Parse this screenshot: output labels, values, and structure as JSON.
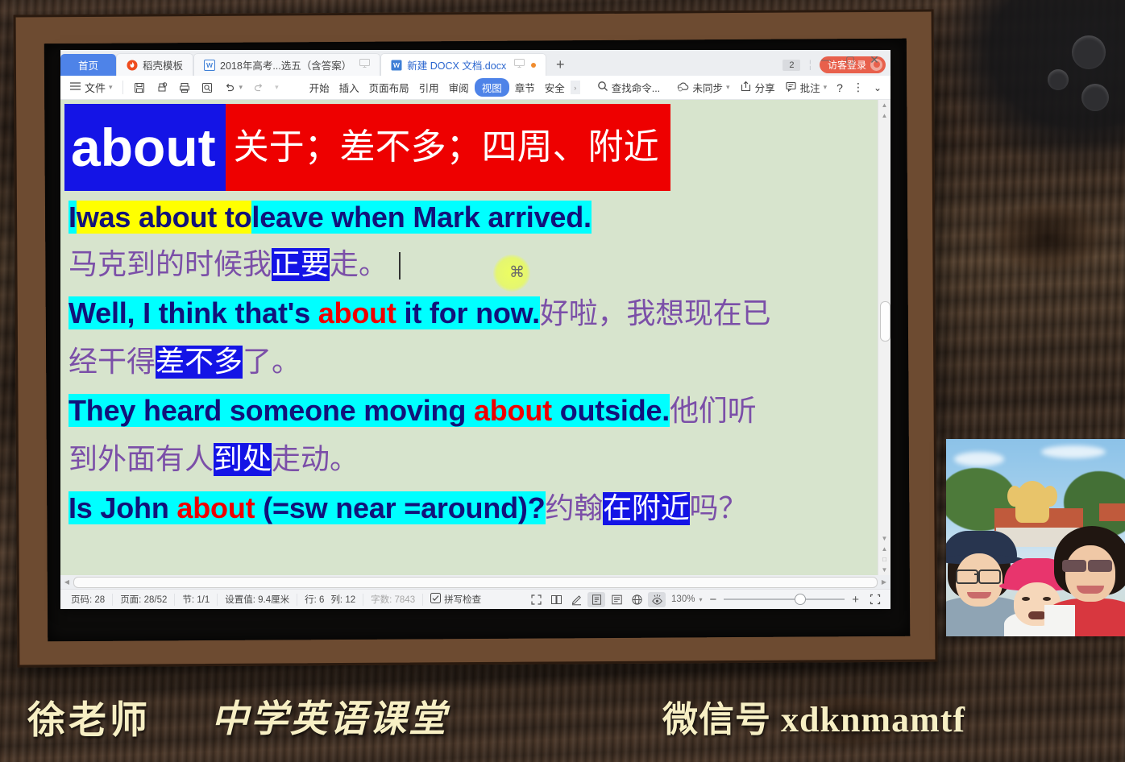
{
  "window": {
    "controls": {
      "minimize": "—",
      "maximize": "▢",
      "close": "✕"
    }
  },
  "tabs": {
    "home_label": "首页",
    "items": [
      {
        "label": "稻壳模板",
        "icon": "docer-flame-icon",
        "state": "inactive"
      },
      {
        "label": "2018年高考...选五（含答案）",
        "icon": "wps-writer-icon",
        "state": "inactive"
      },
      {
        "label": "新建 DOCX 文档.docx",
        "icon": "wps-writer-icon",
        "state": "active"
      }
    ],
    "new_tab_label": "+",
    "count_badge": "2",
    "login_label": "访客登录"
  },
  "ribbon": {
    "menu_icon": "hamburger-icon",
    "file_label": "文件",
    "quick_tools": [
      "save-icon",
      "print-preview-icon",
      "print-icon",
      "find-icon",
      "undo-icon",
      "redo-icon",
      "customize-icon"
    ],
    "menu_items": [
      {
        "label": "开始",
        "active": false
      },
      {
        "label": "插入",
        "active": false
      },
      {
        "label": "页面布局",
        "active": false
      },
      {
        "label": "引用",
        "active": false
      },
      {
        "label": "审阅",
        "active": false
      },
      {
        "label": "视图",
        "active": true
      },
      {
        "label": "章节",
        "active": false
      },
      {
        "label": "安全",
        "active": false
      }
    ],
    "more_arrow": "›",
    "search_placeholder": "查找命令...",
    "sync_label": "未同步",
    "share_label": "分享",
    "comment_label": "批注",
    "help_icon": "?",
    "more_icon": "⋮",
    "collapse_icon": "⌄"
  },
  "document": {
    "title_en": "about",
    "title_cn": "关于；差不多；四周、附近",
    "lines": [
      {
        "id": "line-1-en",
        "segments": [
          {
            "text": "I",
            "style": "cyan"
          },
          {
            "text": "was about to",
            "style": "yellow"
          },
          {
            "text": "leave when Mark arrived.",
            "style": "cyan"
          }
        ]
      },
      {
        "id": "line-1-cn",
        "segments": [
          {
            "text": "马克到的时候我",
            "style": "cn"
          },
          {
            "text": "正要",
            "style": "blue"
          },
          {
            "text": "走。",
            "style": "cn"
          }
        ]
      },
      {
        "id": "line-2-en",
        "segments": [
          {
            "text": "Well, I think that's ",
            "style": "cyan"
          },
          {
            "text": "about",
            "style": "cyan-red"
          },
          {
            "text": " it for now.",
            "style": "cyan"
          },
          {
            "text": "好啦，我想现在已",
            "style": "cn"
          }
        ]
      },
      {
        "id": "line-2-cn",
        "segments": [
          {
            "text": "经干得",
            "style": "cn"
          },
          {
            "text": "差不多",
            "style": "blue"
          },
          {
            "text": "了。",
            "style": "cn"
          }
        ]
      },
      {
        "id": "line-3-en",
        "segments": [
          {
            "text": "They heard someone moving ",
            "style": "cyan"
          },
          {
            "text": "about",
            "style": "cyan-red"
          },
          {
            "text": " outside.",
            "style": "cyan"
          },
          {
            "text": "他们听",
            "style": "cn"
          }
        ]
      },
      {
        "id": "line-3-cn",
        "segments": [
          {
            "text": "到外面有人",
            "style": "cn"
          },
          {
            "text": "到处",
            "style": "blue"
          },
          {
            "text": "走动。",
            "style": "cn"
          }
        ]
      },
      {
        "id": "line-4-en",
        "segments": [
          {
            "text": "Is John ",
            "style": "cyan"
          },
          {
            "text": "about",
            "style": "cyan-red"
          },
          {
            "text": " (=sw near =around)?",
            "style": "cyan"
          },
          {
            "text": "约翰",
            "style": "cn"
          },
          {
            "text": "在附近",
            "style": "blue"
          },
          {
            "text": "吗？",
            "style": "cn"
          }
        ]
      }
    ]
  },
  "statusbar": {
    "page_number": "页码: 28",
    "page_of": "页面: 28/52",
    "section": "节: 1/1",
    "setting": "设置值: 9.4厘米",
    "row": "行: 6",
    "col": "列: 12",
    "word_count": "字数: 7843",
    "spellcheck": "拼写检查",
    "view_icons": [
      "fullscreen-icon",
      "two-page-icon",
      "pen-icon",
      "page-view-icon",
      "outline-view-icon",
      "web-view-icon",
      "eye-protect-icon"
    ],
    "zoom_label": "130%",
    "zoom_out": "−",
    "zoom_in": "+",
    "fit_icon": "fit-page-icon"
  },
  "banner": {
    "teacher": "徐老师",
    "course": "中学英语课堂",
    "wechat": "微信号 xdknmamtf"
  },
  "colors": {
    "accent_blue": "#4e83e8",
    "title_bg_blue": "#1414e6",
    "title_bg_red": "#ee0000",
    "highlight_cyan": "#00ffff",
    "highlight_yellow": "#ffff00",
    "chinese_purple": "#7b4fa8",
    "page_bg": "#d7e4cd",
    "login_red": "#e8604c",
    "banner_text": "#f7efc4"
  }
}
